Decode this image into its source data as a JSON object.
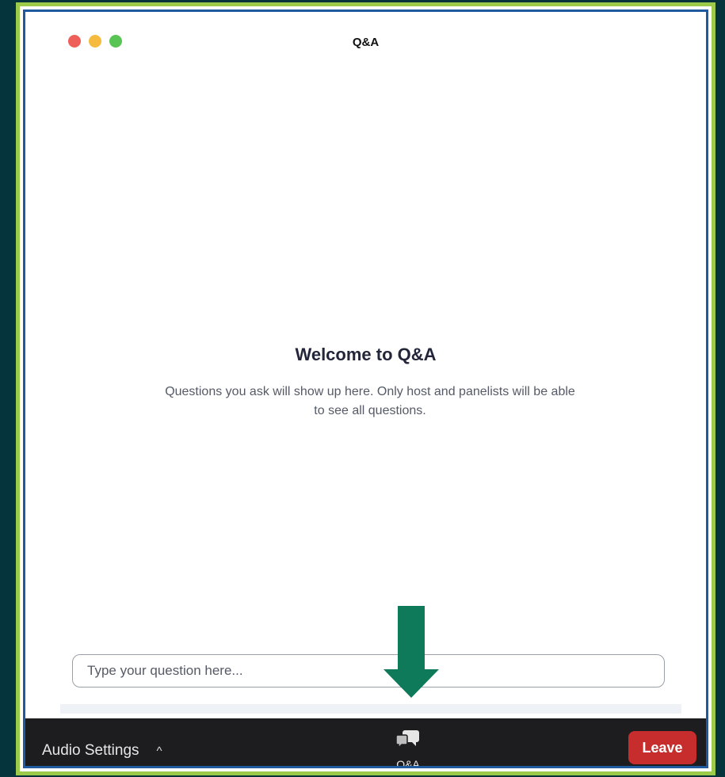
{
  "window": {
    "title": "Q&A"
  },
  "welcome": {
    "title": "Welcome to Q&A",
    "message": "Questions you ask will show up here. Only host and panelists will be able to see all questions."
  },
  "question_input": {
    "placeholder": "Type your question here...",
    "value": ""
  },
  "toolbar": {
    "audio_settings_label": "Audio Settings",
    "audio_caret": "^",
    "qa_label": "Q&A",
    "leave_label": "Leave"
  },
  "colors": {
    "background": "#06343c",
    "frame_border": "#9ccb4b",
    "inner_border": "#1f5a9e",
    "toolbar": "#1d1d1f",
    "leave_button": "#c72d2d",
    "arrow": "#0e7a5a"
  },
  "icons": {
    "window_controls": [
      "close-icon",
      "minimize-icon",
      "zoom-icon"
    ],
    "qa_icon": "speech-bubbles-icon",
    "annotation": "down-arrow-icon"
  }
}
